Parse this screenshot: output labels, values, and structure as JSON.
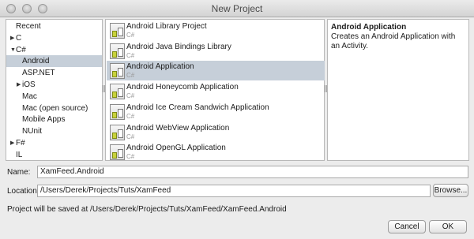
{
  "window": {
    "title": "New Project"
  },
  "categories": [
    {
      "label": "Recent",
      "arrow": "",
      "indent": 0,
      "selected": false
    },
    {
      "label": "C",
      "arrow": "▶",
      "indent": 0,
      "selected": false
    },
    {
      "label": "C#",
      "arrow": "▼",
      "indent": 0,
      "selected": false
    },
    {
      "label": "Android",
      "arrow": "",
      "indent": 1,
      "selected": true
    },
    {
      "label": "ASP.NET",
      "arrow": "",
      "indent": 1,
      "selected": false
    },
    {
      "label": "iOS",
      "arrow": "▶",
      "indent": 1,
      "selected": false
    },
    {
      "label": "Mac",
      "arrow": "",
      "indent": 1,
      "selected": false
    },
    {
      "label": "Mac (open source)",
      "arrow": "",
      "indent": 1,
      "selected": false
    },
    {
      "label": "Mobile Apps",
      "arrow": "",
      "indent": 1,
      "selected": false
    },
    {
      "label": "NUnit",
      "arrow": "",
      "indent": 1,
      "selected": false
    },
    {
      "label": "F#",
      "arrow": "▶",
      "indent": 0,
      "selected": false
    },
    {
      "label": "IL",
      "arrow": "",
      "indent": 0,
      "selected": false
    }
  ],
  "templates": [
    {
      "name": "Android Library Project",
      "lang": "C#",
      "selected": false
    },
    {
      "name": "Android Java Bindings Library",
      "lang": "C#",
      "selected": false
    },
    {
      "name": "Android Application",
      "lang": "C#",
      "selected": true
    },
    {
      "name": "Android Honeycomb Application",
      "lang": "C#",
      "selected": false
    },
    {
      "name": "Android Ice Cream Sandwich Application",
      "lang": "C#",
      "selected": false
    },
    {
      "name": "Android WebView Application",
      "lang": "C#",
      "selected": false
    },
    {
      "name": "Android OpenGL Application",
      "lang": "C#",
      "selected": false
    }
  ],
  "description": {
    "title": "Android Application",
    "text": "Creates an Android Application with an Activity."
  },
  "form": {
    "name_label": "Name:",
    "name_value": "XamFeed.Android",
    "location_label": "Location:",
    "location_value": "/Users/Derek/Projects/Tuts/XamFeed",
    "browse_label": "Browse...",
    "save_info": "Project will be saved at /Users/Derek/Projects/Tuts/XamFeed/XamFeed.Android"
  },
  "buttons": {
    "cancel": "Cancel",
    "ok": "OK"
  }
}
